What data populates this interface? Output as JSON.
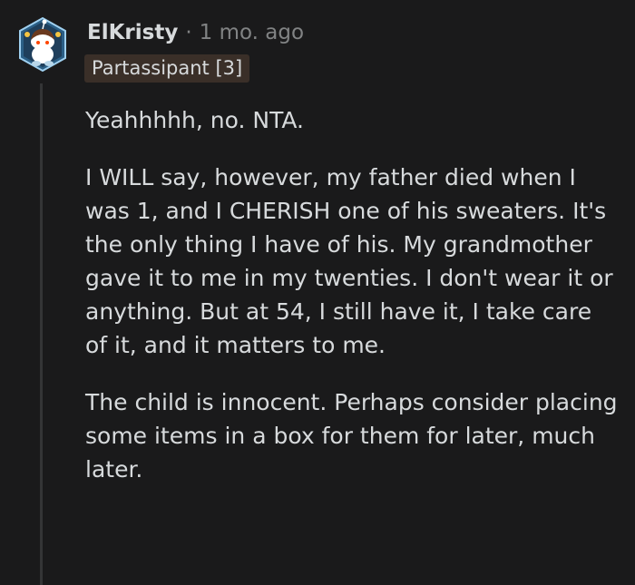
{
  "comment": {
    "username": "ElKristy",
    "separator": "·",
    "timestamp": "1 mo. ago",
    "flair": "Partassipant [3]",
    "paragraphs": [
      "Yeahhhhh, no. NTA.",
      "I WILL say, however, my father died when I was 1, and I CHERISH one of his sweaters. It's the only thing I have of his. My grandmother gave it to me in my twenties. I don't wear it or anything. But at 54, I still have it, I take care of it, and it matters to me.",
      "The child is innocent. Perhaps consider placing some items in a box for them for later, much later."
    ]
  },
  "icons": {
    "avatar": "snoo-avatar-icon"
  },
  "colors": {
    "background": "#1a1a1b",
    "text": "#d7dadc",
    "meta": "#818384",
    "flair_bg": "#3a2f28",
    "thread_line": "#343536"
  }
}
